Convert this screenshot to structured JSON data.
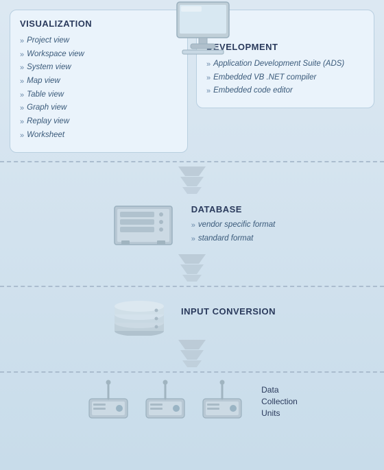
{
  "visualization": {
    "title": "VISUALIZATION",
    "items": [
      "Project view",
      "Workspace view",
      "System view",
      "Map view",
      "Table view",
      "Graph view",
      "Replay view",
      "Worksheet"
    ]
  },
  "development": {
    "title": "DEVELOPMENT",
    "items": [
      "Application Development Suite (ADS)",
      "Embedded VB .NET compiler",
      "Embedded code editor"
    ]
  },
  "database": {
    "title": "DATABASE",
    "items": [
      "vendor specific format",
      "standard format"
    ]
  },
  "input_conversion": {
    "title": "INPUT CONVERSION"
  },
  "data_collection": {
    "label_line1": "Data",
    "label_line2": "Collection",
    "label_line3": "Units"
  },
  "bullets": {
    "symbol": "»"
  }
}
